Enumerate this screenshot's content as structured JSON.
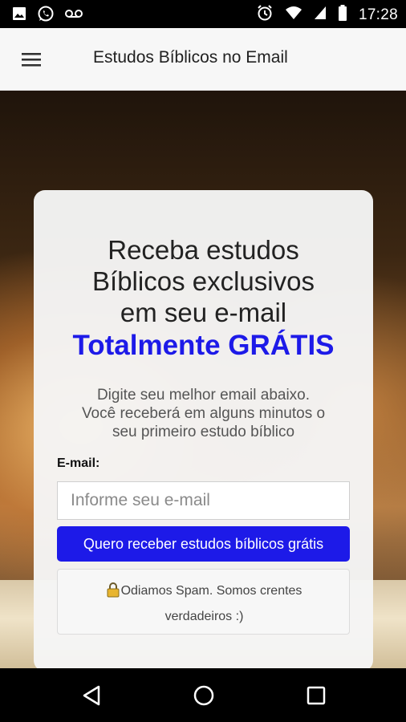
{
  "status_bar": {
    "time": "17:28",
    "icons": [
      "image-icon",
      "whatsapp-icon",
      "voicemail-icon",
      "alarm-icon",
      "wifi-icon",
      "signal-icon",
      "battery-icon"
    ]
  },
  "app_bar": {
    "title": "Estudos Bíblicos no Email",
    "menu_icon": "hamburger-menu-icon"
  },
  "card": {
    "headline_line1": "Receba estudos",
    "headline_line2": "Bíblicos exclusivos",
    "headline_line3": "em seu e-mail",
    "headline_accent": "Totalmente GRÁTIS",
    "subtext_line1": "Digite seu melhor email abaixo.",
    "subtext_line2": "Você receberá em alguns minutos o",
    "subtext_line3": "seu primeiro estudo bíblico",
    "email_label": "E-mail:",
    "email_placeholder": "Informe seu e-mail",
    "email_value": "",
    "submit_label": "Quero receber estudos bíblicos grátis",
    "spam_line1": "Odiamos Spam. Somos crentes",
    "spam_line2": "verdadeiros :)"
  },
  "colors": {
    "accent": "#1d1ae8",
    "appbar_bg": "#f7f7f7"
  },
  "nav_bar": {
    "icons": [
      "back-icon",
      "home-icon",
      "recents-icon"
    ]
  }
}
